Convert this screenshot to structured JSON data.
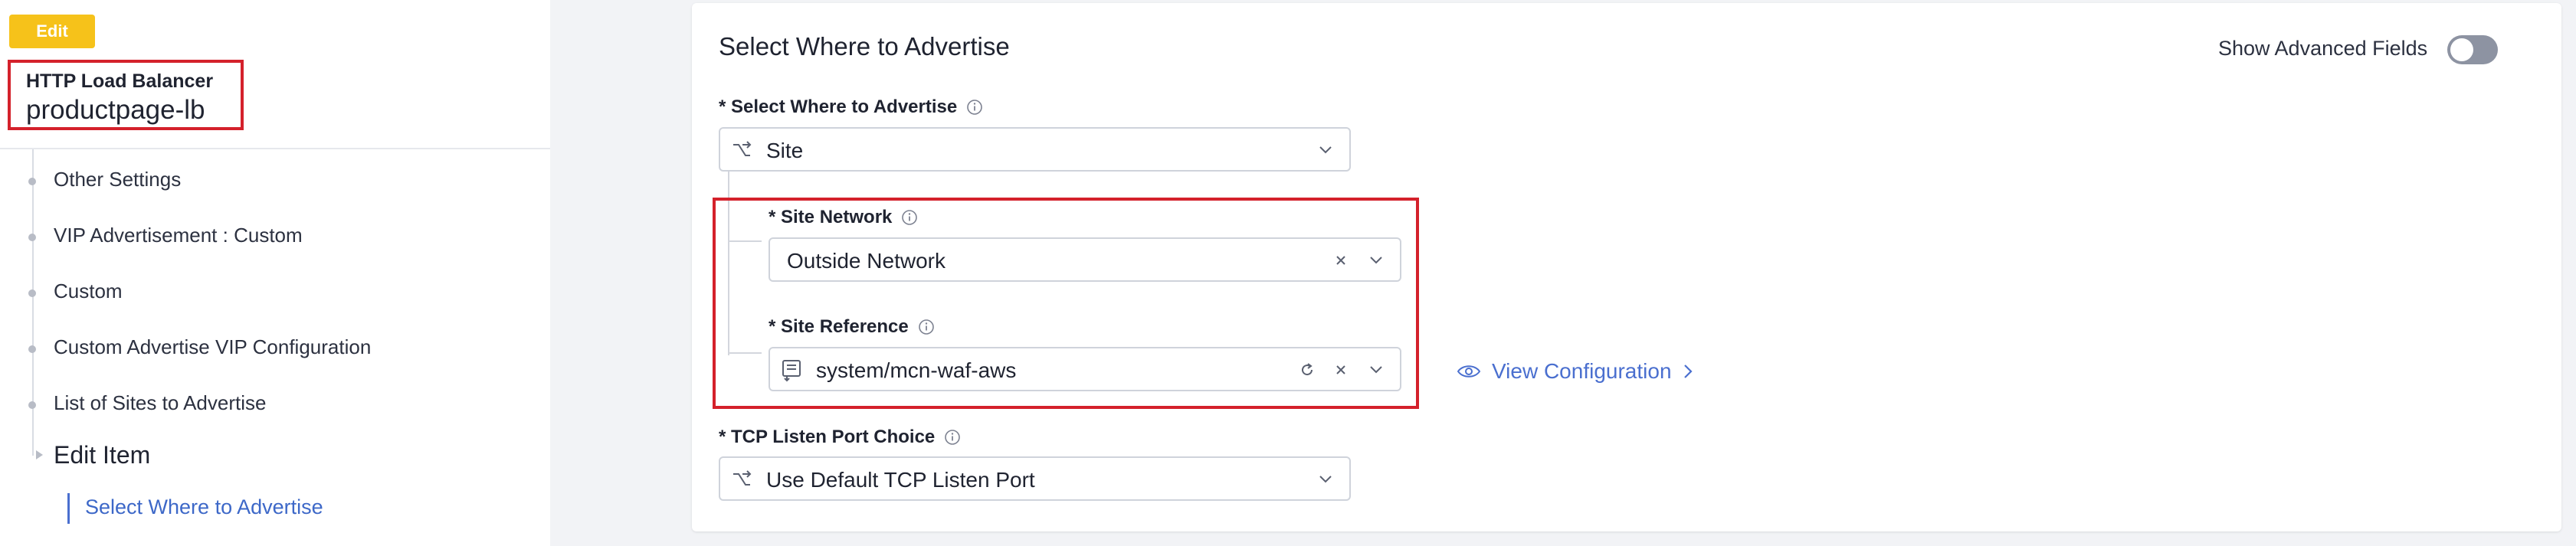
{
  "left_panel": {
    "edit_badge": "Edit",
    "lb_type": "HTTP Load Balancer",
    "lb_name": "productpage-lb",
    "nav_items": [
      "Other Settings",
      "VIP Advertisement : Custom",
      "Custom",
      "Custom Advertise VIP Configuration",
      "List of Sites to Advertise"
    ],
    "edit_item": "Edit Item",
    "current_item": "Select Where to Advertise"
  },
  "main": {
    "section_title": "Select Where to Advertise",
    "show_advanced_label": "Show Advanced Fields",
    "show_advanced_on": false,
    "where_to_advertise": {
      "label": "* Select Where to Advertise",
      "value": "Site",
      "icon": "branch-icon"
    },
    "site_network": {
      "label": "* Site Network",
      "value": "Outside Network"
    },
    "site_reference": {
      "label": "* Site Reference",
      "value": "system/mcn-waf-aws",
      "icon": "document-icon"
    },
    "view_configuration": "View Configuration",
    "tcp_listen_port": {
      "label": "* TCP Listen Port Choice",
      "value": "Use Default TCP Listen Port",
      "icon": "branch-icon"
    }
  },
  "colors": {
    "accent": "#4a6fcf",
    "highlight_border": "#d4212b",
    "edit_badge": "#f6c21a",
    "toggle_off": "#8d93a2"
  }
}
